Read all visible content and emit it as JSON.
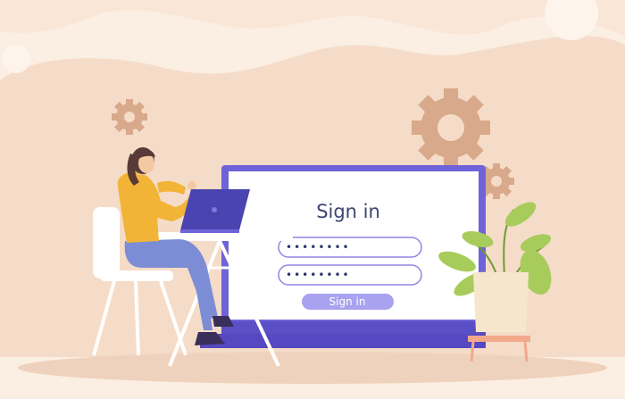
{
  "colors": {
    "background": "#fbeee2",
    "blob": "#f5dcc8",
    "gear": "#d8a98a",
    "monitor_frame": "#6f63d9",
    "monitor_stand": "#5a4fc4",
    "screen": "#ffffff",
    "accent_button": "#a9a2ef",
    "plant_leaf": "#a8cc5c",
    "pot": "#f6e7cc",
    "shirt": "#f2b436",
    "pants": "#7c8dd6",
    "hair": "#5a3a36"
  },
  "icons": [
    "gear-icon",
    "gear-icon",
    "gear-icon"
  ],
  "login": {
    "title": "Sign in",
    "username_value": "••••••••",
    "password_value": "••••••••",
    "button_label": "Sign in"
  }
}
